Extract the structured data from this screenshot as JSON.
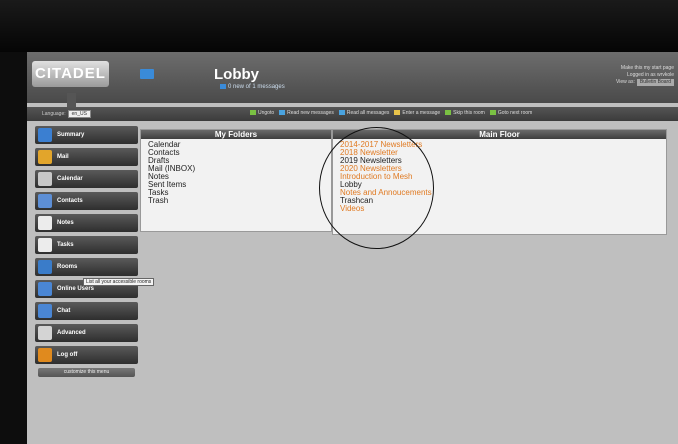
{
  "banner": {
    "logo": "CITADEL",
    "room_title": "Lobby",
    "room_subtitle": "0 new of 1 messages",
    "right_line1": "Make this my start page",
    "right_line2": "Logged in as wrvkole",
    "view_as_label": "View as:",
    "view_as_value": "Bulletin Board"
  },
  "toolbar": {
    "language_label": "Language:",
    "language_value": "en_US",
    "actions": [
      {
        "label": "Ungoto",
        "color": "#7ac143"
      },
      {
        "label": "Read new messages",
        "color": "#4aa3df"
      },
      {
        "label": "Read all messages",
        "color": "#4aa3df"
      },
      {
        "label": "Enter a message",
        "color": "#e8c34a"
      },
      {
        "label": "Skip this room",
        "color": "#7ac143"
      },
      {
        "label": "Goto next room",
        "color": "#7ac143"
      }
    ]
  },
  "sidebar": {
    "items": [
      {
        "label": "Summary",
        "icon": "globe-icon",
        "color": "#3b7fd1"
      },
      {
        "label": "Mail",
        "icon": "mail-icon",
        "color": "#e2a52b"
      },
      {
        "label": "Calendar",
        "icon": "calendar-icon",
        "color": "#c8c8c8"
      },
      {
        "label": "Contacts",
        "icon": "contacts-icon",
        "color": "#5d8fd6"
      },
      {
        "label": "Notes",
        "icon": "notes-icon",
        "color": "#ececec"
      },
      {
        "label": "Tasks",
        "icon": "tasks-icon",
        "color": "#ececec"
      },
      {
        "label": "Rooms",
        "icon": "rooms-icon",
        "color": "#3a7cc9"
      },
      {
        "label": "Online Users",
        "icon": "user-icon",
        "color": "#4a86d4"
      },
      {
        "label": "Chat",
        "icon": "chat-icon",
        "color": "#4a86d4"
      },
      {
        "label": "Advanced",
        "icon": "gear-icon",
        "color": "#d4d4d4"
      },
      {
        "label": "Log off",
        "icon": "power-icon",
        "color": "#e08a1e"
      }
    ],
    "customize": "customize this menu",
    "tooltip": "List all your accessible rooms"
  },
  "my_folders": {
    "title": "My Folders",
    "items": [
      "Calendar",
      "Contacts",
      "Drafts",
      "Mail  (INBOX)",
      "Notes",
      "Sent Items",
      "Tasks",
      "Trash"
    ]
  },
  "main_floor": {
    "title": "Main Floor",
    "rooms": [
      {
        "name": "2014-2017 Newsletters",
        "unread": true
      },
      {
        "name": "2018 Newsletter",
        "unread": true
      },
      {
        "name": "2019 Newsletters",
        "unread": false
      },
      {
        "name": "2020 Newsletters",
        "unread": true
      },
      {
        "name": "Introduction to Mesh",
        "unread": true
      },
      {
        "name": "Lobby",
        "unread": false
      },
      {
        "name": "Notes and Annoucements",
        "unread": true
      },
      {
        "name": "Trashcan",
        "unread": false
      },
      {
        "name": "Videos",
        "unread": true
      }
    ]
  }
}
